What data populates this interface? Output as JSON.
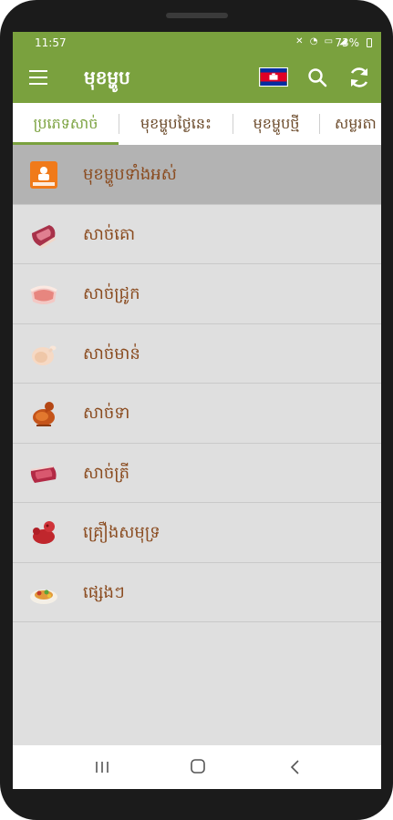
{
  "status_bar": {
    "time": "11:57",
    "icons": [
      "mute-icon",
      "wifi-icon",
      "lte-icon",
      "signal-icon"
    ],
    "battery": "73%"
  },
  "app_bar": {
    "title": "មុខម្ហូប",
    "flag": "cambodia-flag-icon"
  },
  "tabs": [
    {
      "label": "ប្រភេទសាច់",
      "active": true
    },
    {
      "label": "មុខម្ហូបថ្ងៃនេះ",
      "active": false
    },
    {
      "label": "មុខម្ហូបថ្មី",
      "active": false
    },
    {
      "label": "សម្លរតា",
      "active": false
    }
  ],
  "list": [
    {
      "label": "មុខម្ហូបទាំងអស់",
      "icon": "all-dishes-icon",
      "selected": true
    },
    {
      "label": "សាច់គោ",
      "icon": "beef-icon",
      "selected": false
    },
    {
      "label": "សាច់ជ្រូក",
      "icon": "pork-icon",
      "selected": false
    },
    {
      "label": "សាច់មាន់",
      "icon": "chicken-icon",
      "selected": false
    },
    {
      "label": "សាច់ទា",
      "icon": "duck-icon",
      "selected": false
    },
    {
      "label": "សាច់ត្រី",
      "icon": "fish-icon",
      "selected": false
    },
    {
      "label": "គ្រឿងសមុទ្រ",
      "icon": "seafood-icon",
      "selected": false
    },
    {
      "label": "ផ្សេងៗ",
      "icon": "other-dishes-icon",
      "selected": false
    }
  ],
  "colors": {
    "primary": "#7aa13e",
    "label": "#8a4b1f",
    "list_bg": "#dfdfdf",
    "selected_bg": "#b3b3b3",
    "flag_blue": "#032ea1",
    "flag_red": "#e00025"
  }
}
